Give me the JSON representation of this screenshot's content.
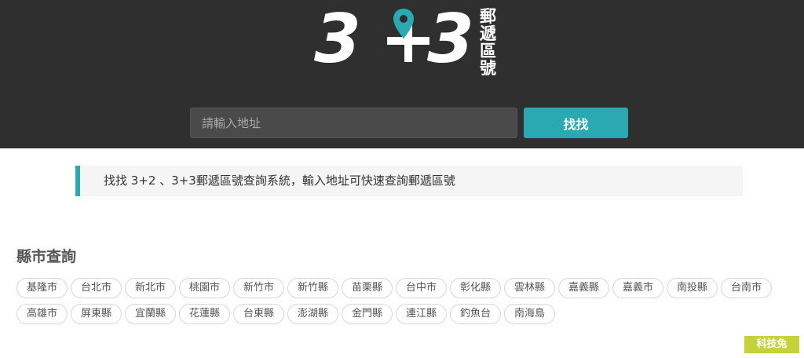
{
  "header": {
    "logo": {
      "digit_left": "3",
      "plus": "+",
      "digit_right": "3",
      "subtitle": "郵遞區號",
      "text_color": "#ffffff",
      "pin_color": "#2aa9b3"
    },
    "search": {
      "placeholder": "請輸入地址",
      "value": "",
      "button_label": "找找"
    },
    "background": "#2f2f2f"
  },
  "notice": {
    "text": "找找 3+2 、3+3郵遞區號查詢系統，輸入地址可快速查詢郵遞區號",
    "accent": "#2aa9b3"
  },
  "counties": {
    "title": "縣市查詢",
    "items": [
      "基隆市",
      "台北市",
      "新北市",
      "桃園市",
      "新竹市",
      "新竹縣",
      "苗栗縣",
      "台中市",
      "彰化縣",
      "雲林縣",
      "嘉義縣",
      "嘉義市",
      "南投縣",
      "台南市",
      "高雄市",
      "屏東縣",
      "宜蘭縣",
      "花蓮縣",
      "台東縣",
      "澎湖縣",
      "金門縣",
      "連江縣",
      "釣魚台",
      "南海島"
    ]
  },
  "watermark": "科技兔"
}
